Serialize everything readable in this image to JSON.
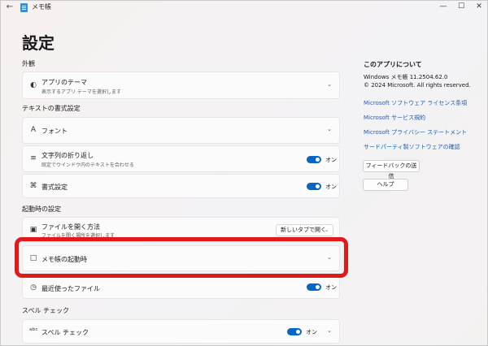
{
  "window": {
    "title": "メモ帳"
  },
  "page": {
    "title": "設定"
  },
  "sections": {
    "appearance": "外観",
    "text_format": "テキストの書式設定",
    "startup": "起動時の設定",
    "spell": "スペル チェック"
  },
  "settings": {
    "theme": {
      "title": "アプリのテーマ",
      "subtitle": "表示するアプリ テーマを選択します"
    },
    "font": {
      "title": "フォント"
    },
    "word_wrap": {
      "title": "文字列の折り返し",
      "subtitle": "既定でウインドウ内のテキストを合わせる",
      "toggle_label": "オン",
      "on": true
    },
    "formatting": {
      "title": "書式設定",
      "toggle_label": "オン",
      "on": true
    },
    "open_file": {
      "title": "ファイルを開く方法",
      "subtitle": "ファイルを開く場所を選択します",
      "select_value": "新しいタブで開く"
    },
    "startup_behavior": {
      "title": "メモ帳の起動時"
    },
    "recent_files": {
      "title": "最近使ったファイル",
      "toggle_label": "オン",
      "on": true
    },
    "spell_check": {
      "title": "スペル チェック",
      "toggle_label": "オン",
      "on": true
    }
  },
  "about": {
    "title": "このアプリについて",
    "version": "Windows メモ帳 11.2504.62.0",
    "copyright": "© 2024 Microsoft. All rights reserved.",
    "links": [
      "Microsoft ソフトウェア ライセンス条項",
      "Microsoft サービス規約",
      "Microsoft プライバシー ステートメント",
      "サードパーティ製ソフトウェアの確認"
    ],
    "feedback_button": "フィードバックの送信",
    "help_button": "ヘルプ"
  },
  "icons": {
    "back": "back-arrow-icon",
    "app": "notepad-app-icon",
    "theme": "palette-icon",
    "font": "font-icon",
    "wrap": "word-wrap-icon",
    "format": "format-icon",
    "open_file": "open-file-icon",
    "startup": "startup-window-icon",
    "recent": "clock-icon",
    "spell": "spell-check-icon"
  },
  "colors": {
    "accent": "#0a64c3",
    "link": "#1f5fb1",
    "highlight": "#e01a1a"
  }
}
